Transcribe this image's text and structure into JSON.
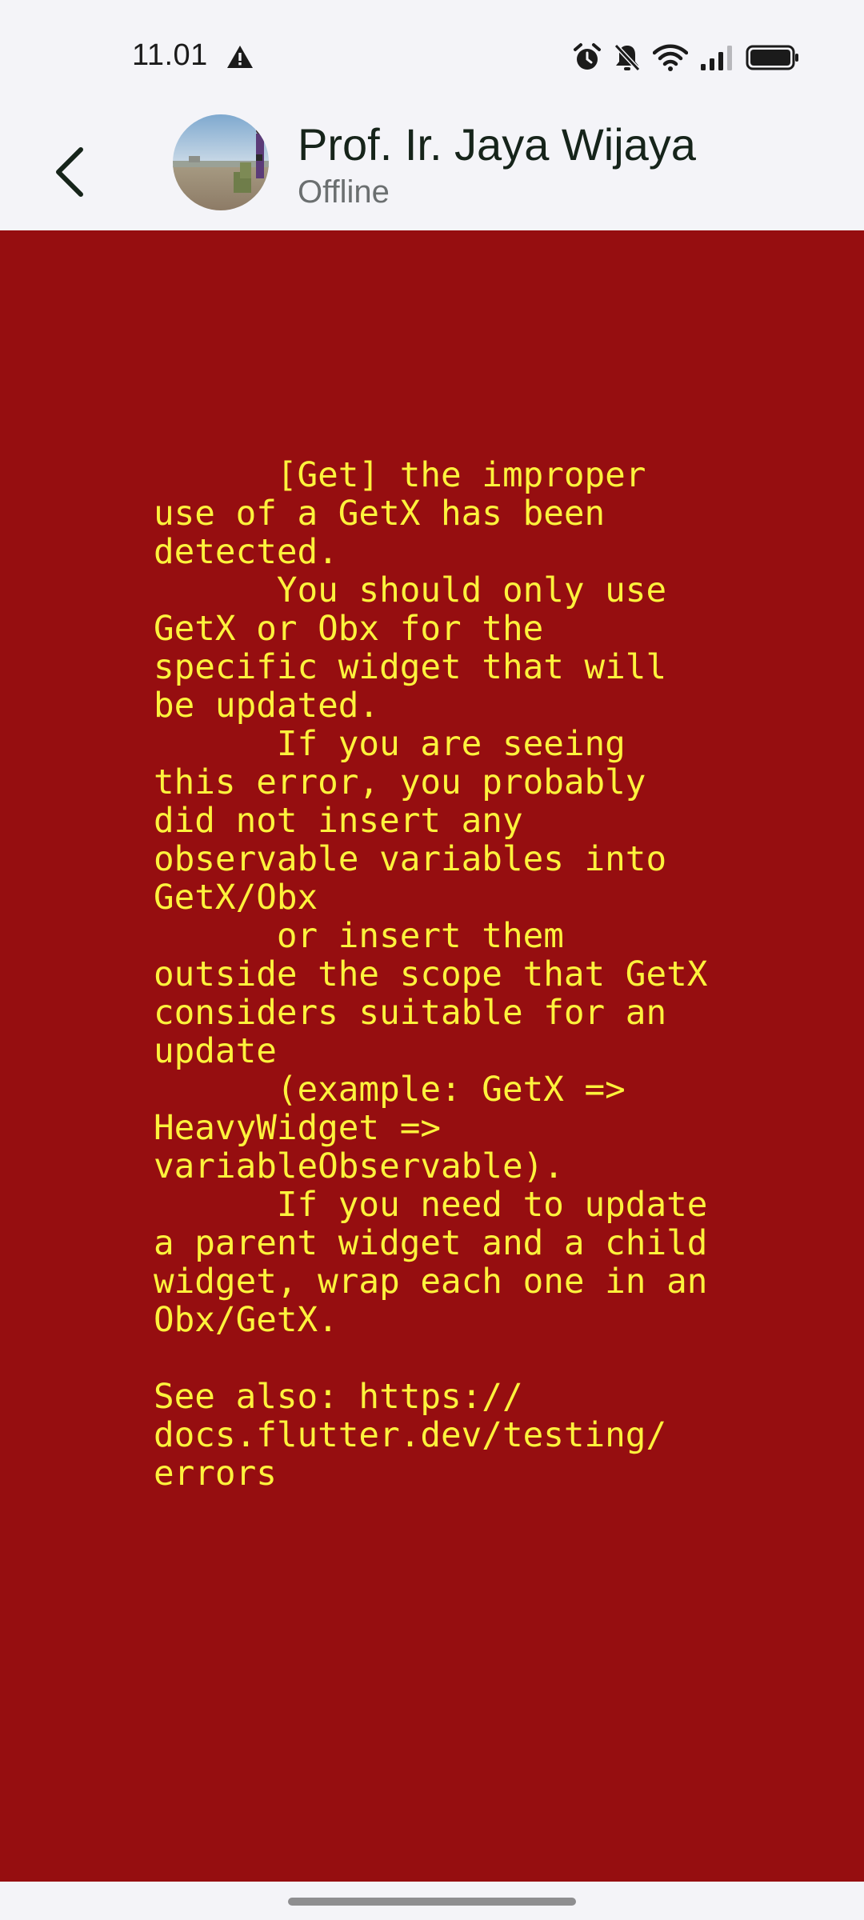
{
  "status_bar": {
    "time": "11.01",
    "icons": [
      "warning-icon",
      "alarm-icon",
      "mute-icon",
      "wifi-icon",
      "signal-icon",
      "battery-icon"
    ]
  },
  "app_bar": {
    "back_icon": "chevron-left-icon",
    "contact_name": "Prof. Ir. Jaya Wijaya",
    "contact_status": "Offline"
  },
  "error": {
    "background_color": "#960e10",
    "text_color": "#fdf23c",
    "message": "      [Get] the improper\nuse of a GetX has been\ndetected.\n      You should only use\nGetX or Obx for the\nspecific widget that will\nbe updated.\n      If you are seeing\nthis error, you probably\ndid not insert any\nobservable variables into\nGetX/Obx\n      or insert them\noutside the scope that GetX\nconsiders suitable for an\nupdate\n      (example: GetX =>\nHeavyWidget =>\nvariableObservable).\n      If you need to update\na parent widget and a child\nwidget, wrap each one in an\nObx/GetX.\n\nSee also: https://\ndocs.flutter.dev/testing/\nerrors"
  }
}
